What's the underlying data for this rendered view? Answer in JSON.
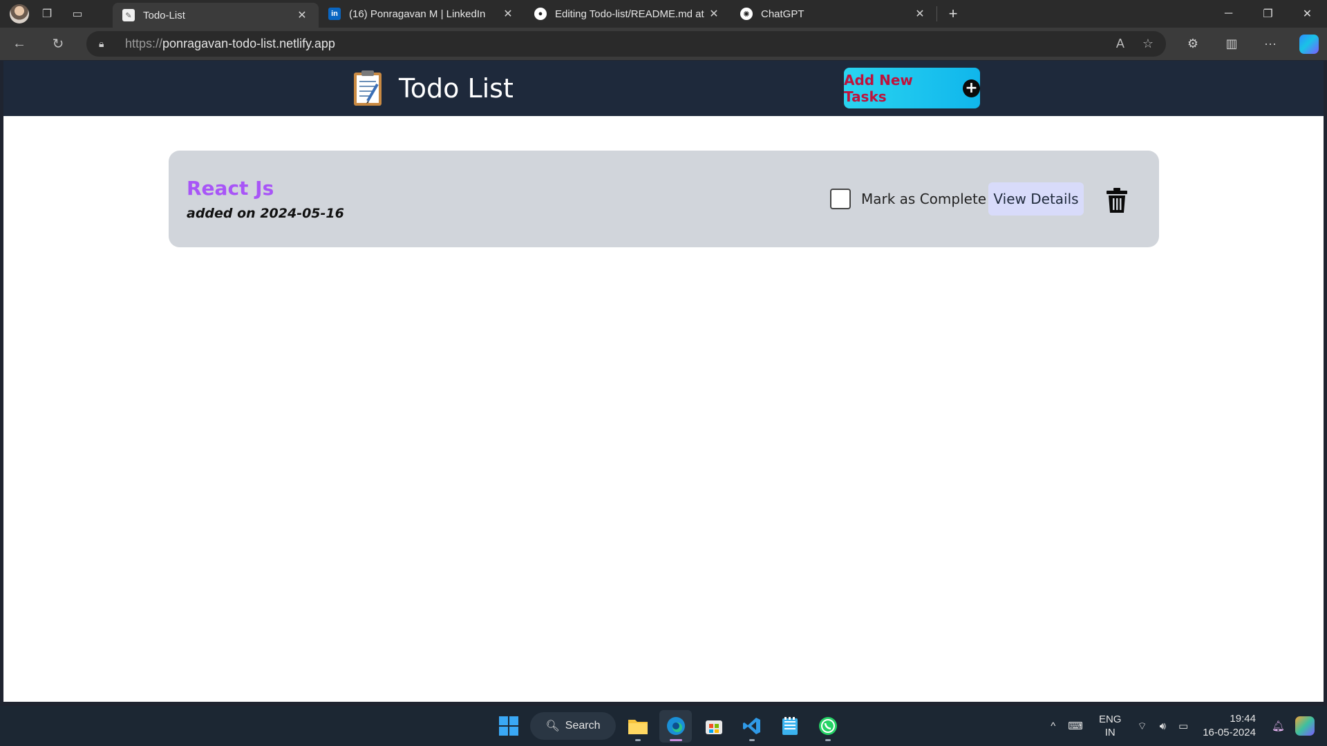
{
  "browser": {
    "tabs": [
      {
        "title": "Todo-List",
        "favicon": "notepad-icon",
        "active": true
      },
      {
        "title": "(16) Ponragavan M | LinkedIn",
        "favicon": "linkedin-icon",
        "active": false
      },
      {
        "title": "Editing Todo-list/README.md at",
        "favicon": "github-icon",
        "active": false
      },
      {
        "title": "ChatGPT",
        "favicon": "chatgpt-icon",
        "active": false
      }
    ],
    "url_protocol": "https://",
    "url_host": "ponragavan-todo-list.netlify.app"
  },
  "app": {
    "title": "Todo List",
    "add_button_label": "Add New Tasks",
    "header_color": "#1e293b",
    "accent_color": "#a855f7"
  },
  "tasks": [
    {
      "title": "React Js",
      "added_on": "added on 2024-05-16",
      "complete_label": "Mark as Complete",
      "completed": false,
      "view_label": "View Details"
    }
  ],
  "taskbar": {
    "search_label": "Search",
    "lang_line1": "ENG",
    "lang_line2": "IN",
    "time": "19:44",
    "date": "16-05-2024"
  }
}
